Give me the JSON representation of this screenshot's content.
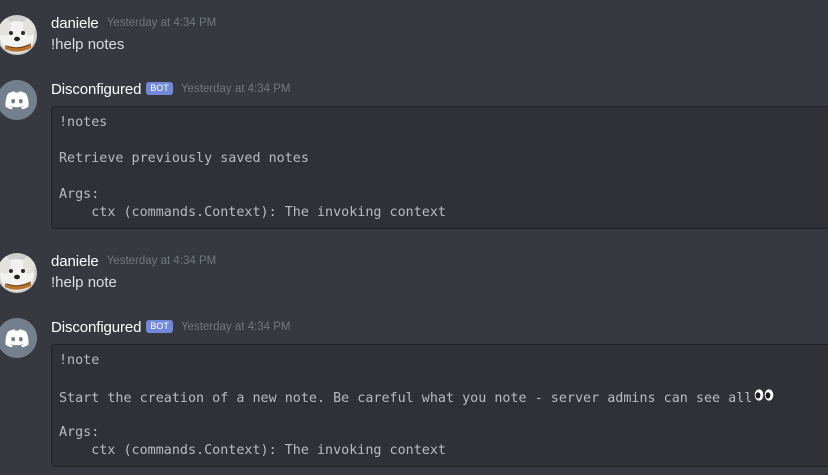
{
  "messages": [
    {
      "username": "daniele",
      "timestamp": "Yesterday at 4:34 PM",
      "text": "!help notes",
      "avatar_icon": "dog-avatar-icon"
    },
    {
      "username": "Disconfigured",
      "badge": "BOT",
      "timestamp": "Yesterday at 4:34 PM",
      "avatar_icon": "discord-logo-icon",
      "code_lines": [
        "!notes",
        "Retrieve previously saved notes",
        "Args:",
        "    ctx (commands.Context): The invoking context"
      ]
    },
    {
      "username": "daniele",
      "timestamp": "Yesterday at 4:34 PM",
      "text": "!help note",
      "avatar_icon": "dog-avatar-icon"
    },
    {
      "username": "Disconfigured",
      "badge": "BOT",
      "timestamp": "Yesterday at 4:34 PM",
      "avatar_icon": "discord-logo-icon",
      "code_lines": [
        "!note",
        "Start the creation of a new note. Be careful what you note - server admins can see all",
        "Args:",
        "    ctx (commands.Context): The invoking context"
      ],
      "emoji_icon": "eyes-emoji-icon"
    }
  ],
  "colors": {
    "background": "#36393f",
    "code_background": "#2f3136",
    "username": "#ffffff",
    "timestamp": "#72767d",
    "text": "#dcddde",
    "bot_badge": "#7289da",
    "discord_avatar_bg": "#747f8d"
  }
}
